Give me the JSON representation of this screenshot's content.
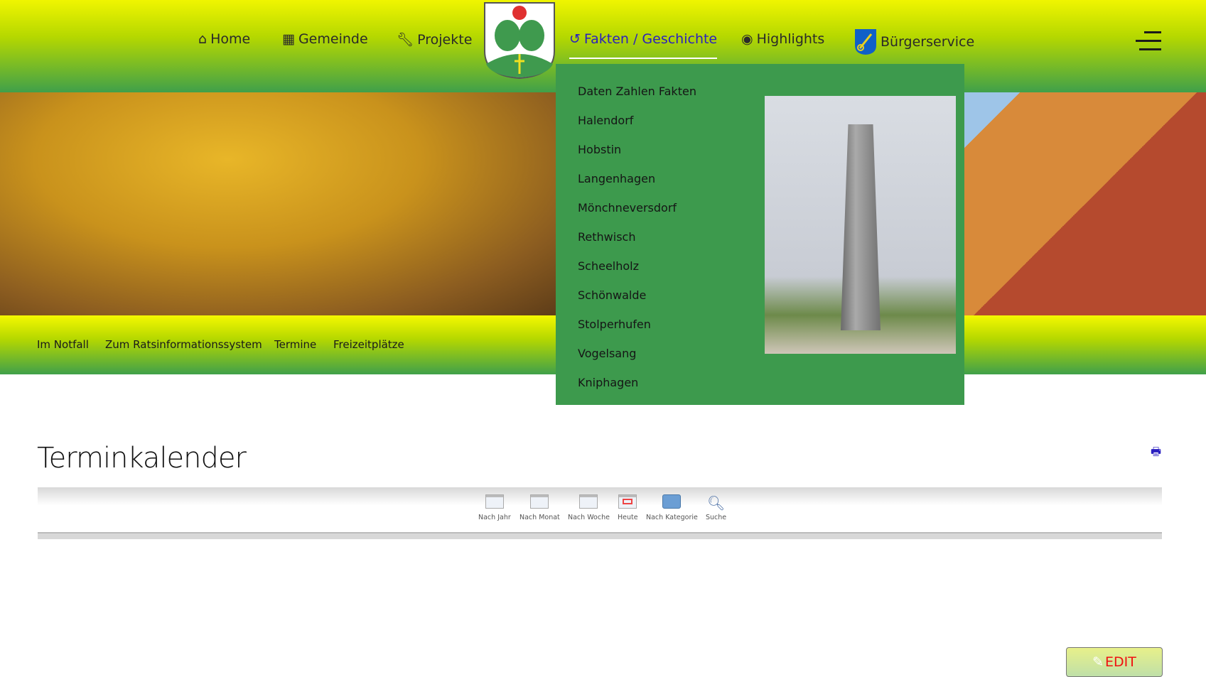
{
  "header": {
    "nav": [
      {
        "label": "Home",
        "icon": "home-icon"
      },
      {
        "label": "Gemeinde",
        "icon": "building-icon"
      },
      {
        "label": "Projekte",
        "icon": "wrench-icon"
      },
      {
        "label": "Fakten / Geschichte",
        "icon": "history-icon",
        "active": true
      },
      {
        "label": "Highlights",
        "icon": "eye-icon"
      },
      {
        "label": "Bürgerservice",
        "icon": "key-shield-icon"
      }
    ],
    "logo": "coat-of-arms",
    "menu_icon": "hamburger-icon"
  },
  "dropdown": {
    "items": [
      "Daten Zahlen Fakten",
      "Halendorf",
      "Hobstin",
      "Langenhagen",
      "Mönchneversdorf",
      "Rethwisch",
      "Scheelholz",
      "Schönwalde",
      "Stolperhufen",
      "Vogelsang",
      "Kniphagen"
    ]
  },
  "subnav": {
    "items": [
      "Im Notfall",
      "Zum Ratsinformationssystem",
      "Termine",
      "Freizeitplätze"
    ],
    "edit_label": "EDIT"
  },
  "main": {
    "title": "Terminkalender",
    "toolbar": [
      {
        "label": "Nach Jahr",
        "icon": "year-calendar-icon"
      },
      {
        "label": "Nach Monat",
        "icon": "month-calendar-icon"
      },
      {
        "label": "Nach Woche",
        "icon": "week-calendar-icon"
      },
      {
        "label": "Heute",
        "icon": "today-calendar-icon"
      },
      {
        "label": "Nach Kategorie",
        "icon": "folder-icon"
      },
      {
        "label": "Suche",
        "icon": "search-icon"
      }
    ]
  },
  "colors": {
    "accent": "#2a1fc0",
    "dropdown_bg": "#3d9a4d",
    "edit_text": "#f01010"
  }
}
